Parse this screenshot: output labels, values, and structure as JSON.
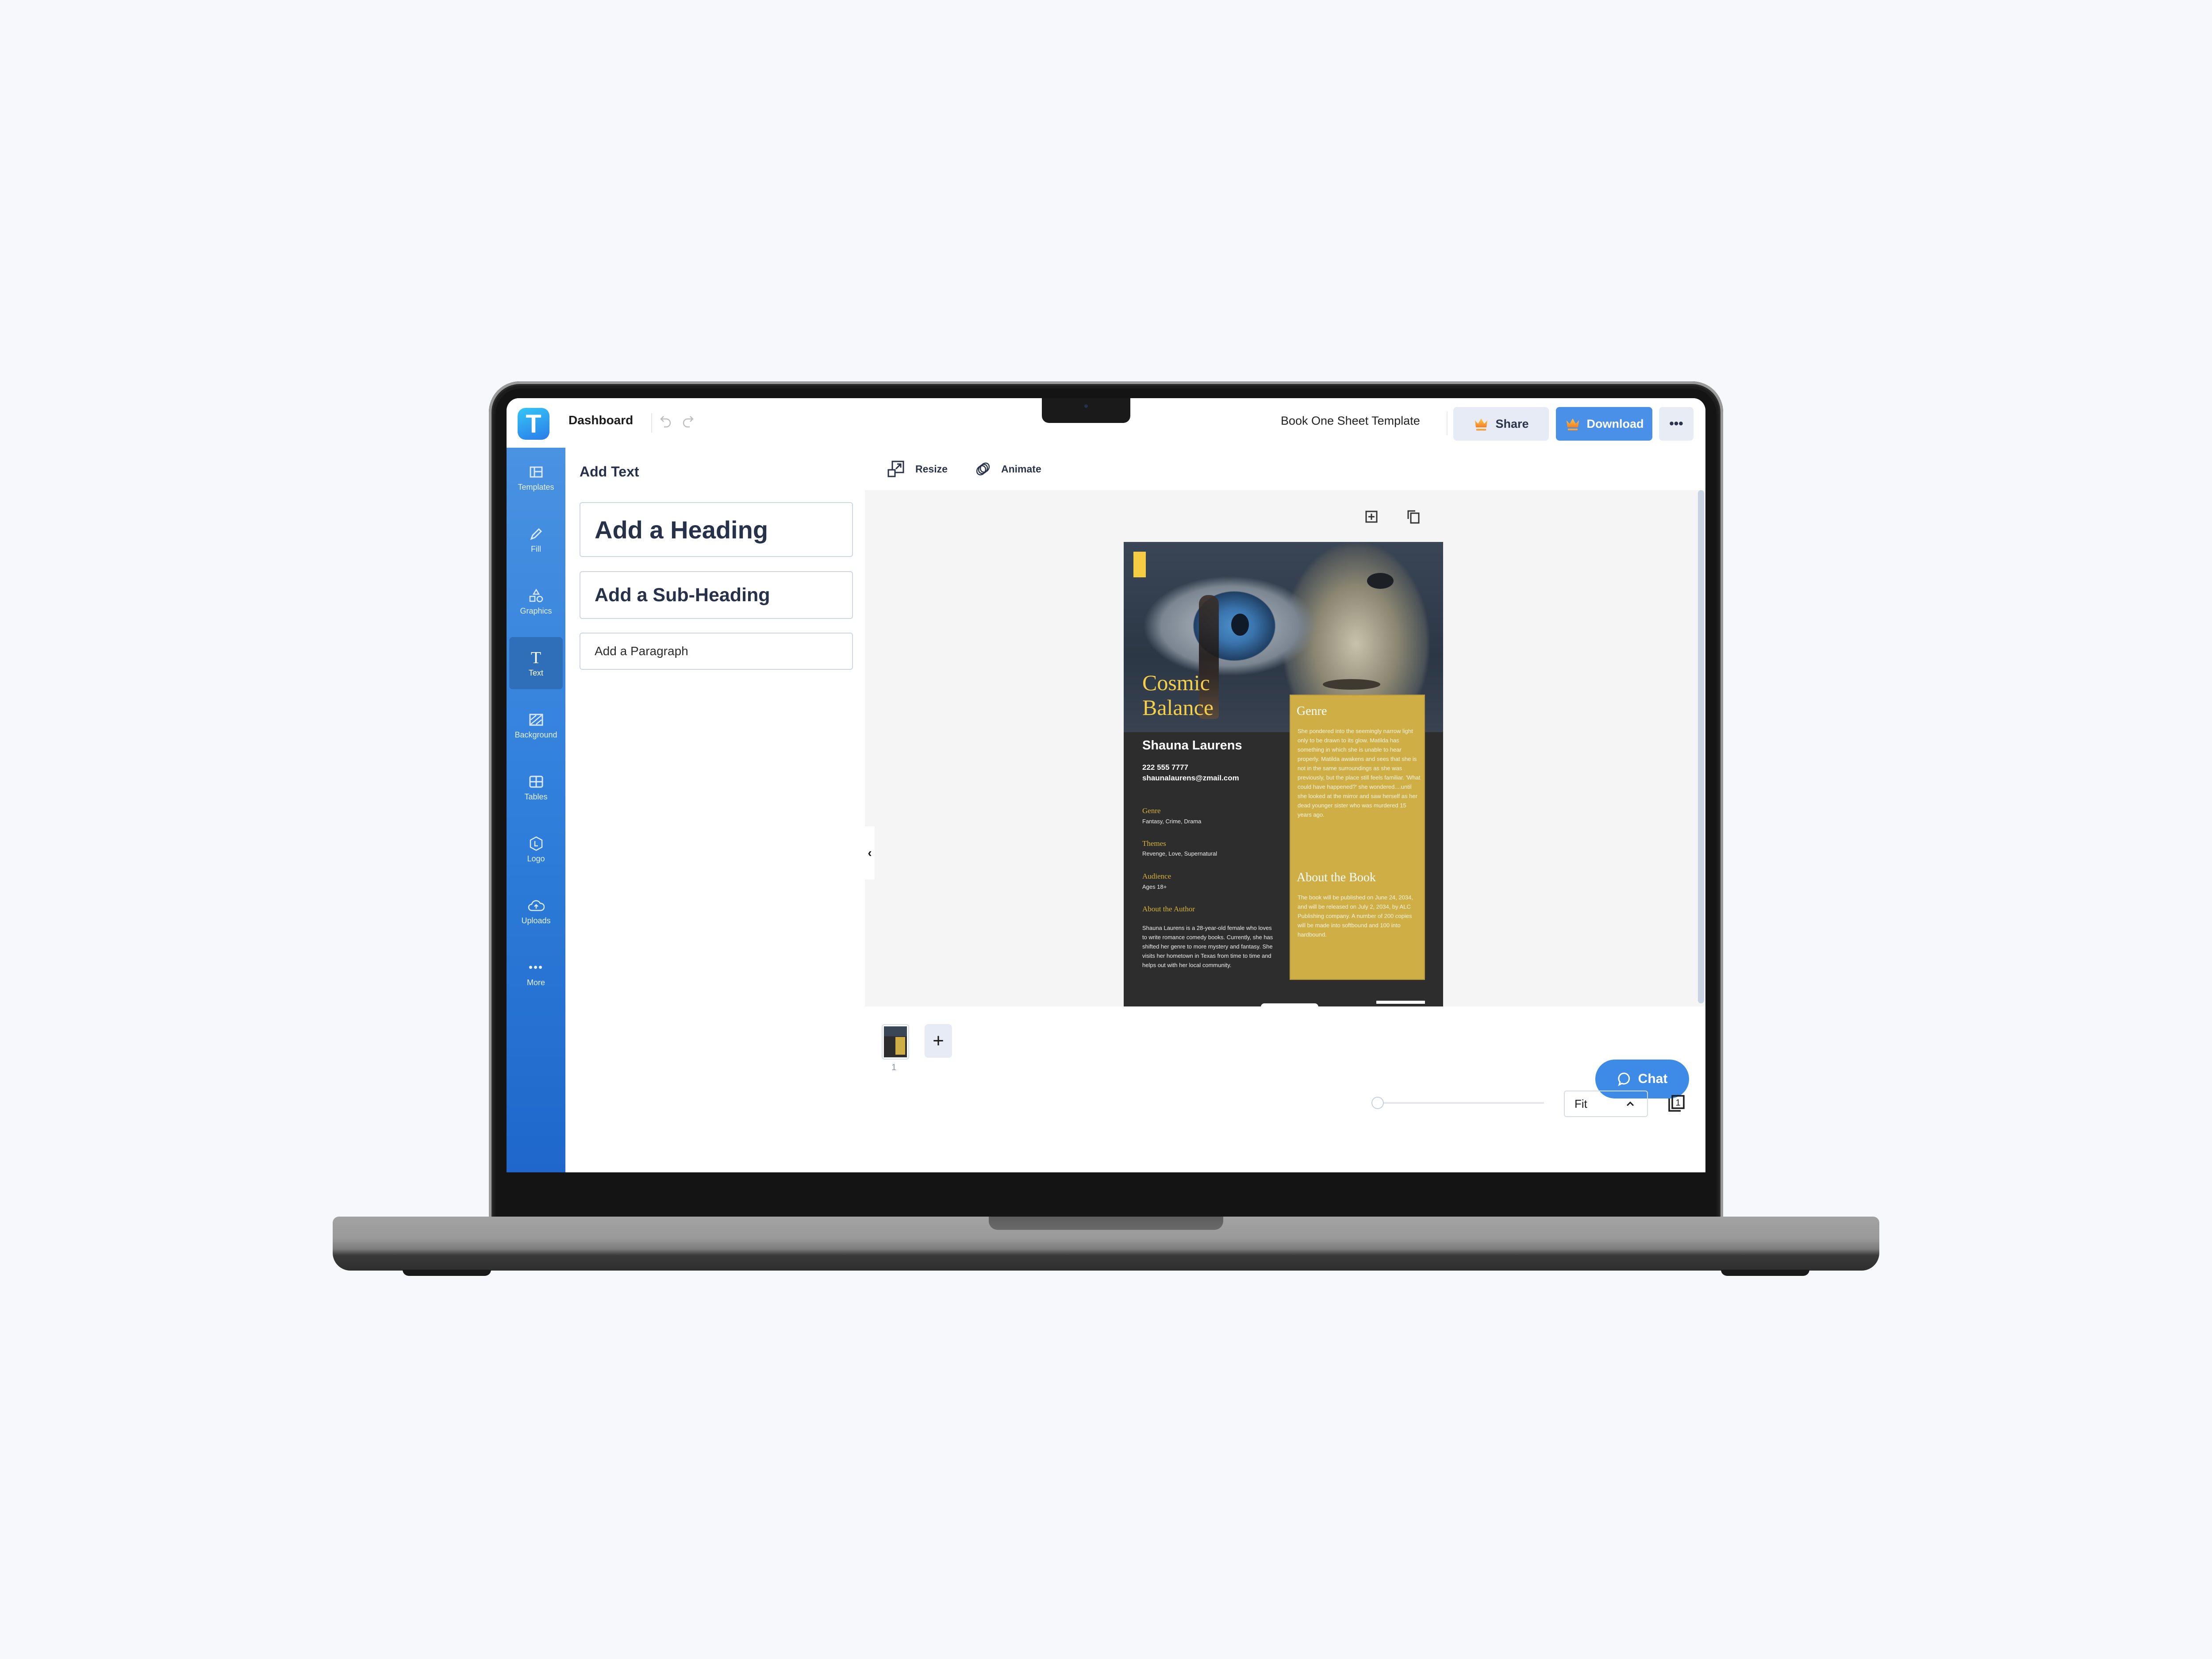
{
  "header": {
    "logo_letter": "T",
    "dashboard_label": "Dashboard",
    "document_title": "Book One Sheet Template",
    "share_label": "Share",
    "download_label": "Download",
    "more_label": "•••"
  },
  "sidebar": {
    "items": [
      {
        "label": "Templates",
        "icon": "templates-icon"
      },
      {
        "label": "Fill",
        "icon": "pencil-icon"
      },
      {
        "label": "Graphics",
        "icon": "shapes-icon"
      },
      {
        "label": "Text",
        "icon": "text-icon",
        "active": true
      },
      {
        "label": "Background",
        "icon": "background-icon"
      },
      {
        "label": "Tables",
        "icon": "table-icon"
      },
      {
        "label": "Logo",
        "icon": "logo-icon"
      },
      {
        "label": "Uploads",
        "icon": "cloud-upload-icon"
      },
      {
        "label": "More",
        "icon": "more-icon"
      }
    ]
  },
  "text_panel": {
    "title": "Add Text",
    "heading": "Add a Heading",
    "subheading": "Add a Sub-Heading",
    "paragraph": "Add a Paragraph"
  },
  "canvas_toolbar": {
    "resize_label": "Resize",
    "animate_label": "Animate"
  },
  "design": {
    "title_line1": "Cosmic",
    "title_line2": "Balance",
    "author": "Shauna Laurens",
    "phone": "222 555 7777",
    "email": "shaunalaurens@zmail.com",
    "genre_label": "Genre",
    "genre_value": "Fantasy, Crime, Drama",
    "themes_label": "Themes",
    "themes_value": "Revenge, Love, Supernatural",
    "audience_label": "Audience",
    "audience_value": "Ages 18+",
    "about_author_label": "About the Author",
    "about_author_text": "Shauna Laurens is a 28-year-old female who loves to write romance comedy books. Currently, she has shifted her genre to more mystery and fantasy. She visits her hometown in Texas from time to time and helps out with her local community.",
    "box_genre_label": "Genre",
    "box_genre_text": "She pondered into the seemingly narrow light only to be drawn to its glow. Matilda has something in which she is unable to hear properly. Matilda awakens and sees that she is not in the same surroundings as she was previously, but the place still feels familiar. 'What could have happened?' she wondered....until she looked at the mirror and saw herself as her dead younger sister who was murdered 15 years ago.",
    "about_book_label": "About the Book",
    "about_book_text": "The book will be published on June 24, 2034, and will be released on July 2, 2034, by ALC Publishing company. A number of 200 copies will be made into softbound and 100 into hardbound.",
    "colors": {
      "accent_yellow": "#f5cf48",
      "box_gold": "#cfae45",
      "dark_bg": "#2d2d2d"
    }
  },
  "pages": {
    "thumbnails": [
      {
        "number": "1"
      }
    ],
    "add_label": "+"
  },
  "footer": {
    "chat_label": "Chat",
    "zoom_mode": "Fit",
    "page_count_badge": "1",
    "zoom_slider_value": 0
  },
  "colors": {
    "primary_blue": "#4a90e8",
    "sidebar_blue": "#2f7fdb",
    "text_dark": "#27324a"
  }
}
